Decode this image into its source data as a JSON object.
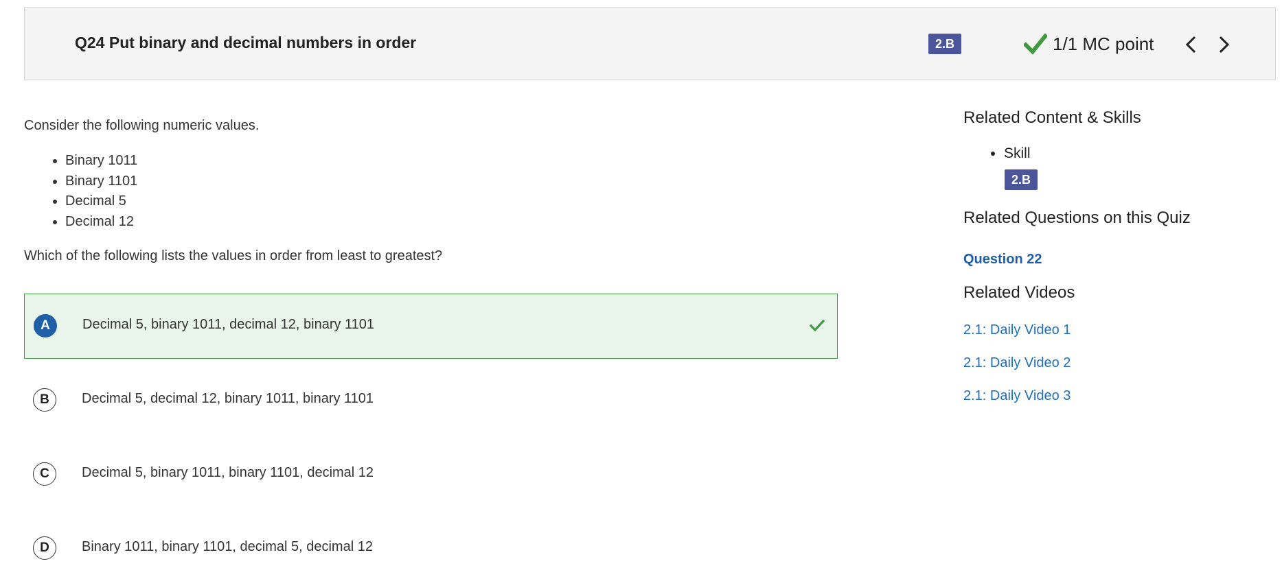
{
  "header": {
    "title": "Q24 Put binary and decimal numbers in order",
    "skill_badge": "2.B",
    "score": "1/1 MC point",
    "score_icon": "check-icon",
    "nav_prev_icon": "chevron-left-icon",
    "nav_next_icon": "chevron-right-icon"
  },
  "question": {
    "intro": "Consider the following numeric values.",
    "values": [
      "Binary 1011",
      "Binary 1101",
      "Decimal 5",
      "Decimal 12"
    ],
    "prompt": "Which of the following lists the values in order from least to greatest?"
  },
  "choices": [
    {
      "letter": "A",
      "text": "Decimal 5, binary 1011, decimal 12, binary 1101",
      "selected": true,
      "correct": true
    },
    {
      "letter": "B",
      "text": "Decimal 5, decimal 12, binary 1011, binary 1101",
      "selected": false,
      "correct": false
    },
    {
      "letter": "C",
      "text": "Decimal 5, binary 1011, binary 1101, decimal 12",
      "selected": false,
      "correct": false
    },
    {
      "letter": "D",
      "text": "Binary 1011, binary 1101, decimal 5, decimal 12",
      "selected": false,
      "correct": false
    }
  ],
  "sidebar": {
    "content_heading": "Related Content & Skills",
    "skill_label": "Skill",
    "skill_badge": "2.B",
    "questions_heading": "Related Questions on this Quiz",
    "related_question": "Question 22",
    "videos_heading": "Related Videos",
    "videos": [
      "2.1: Daily Video 1",
      "2.1: Daily Video 2",
      "2.1: Daily Video 3"
    ]
  },
  "colors": {
    "badge": "#4a559a",
    "correct_green": "#3f9a3f",
    "selected_bg": "#e9f4ea",
    "link_blue": "#1f6fbf",
    "selected_letter": "#1f5fa8"
  }
}
